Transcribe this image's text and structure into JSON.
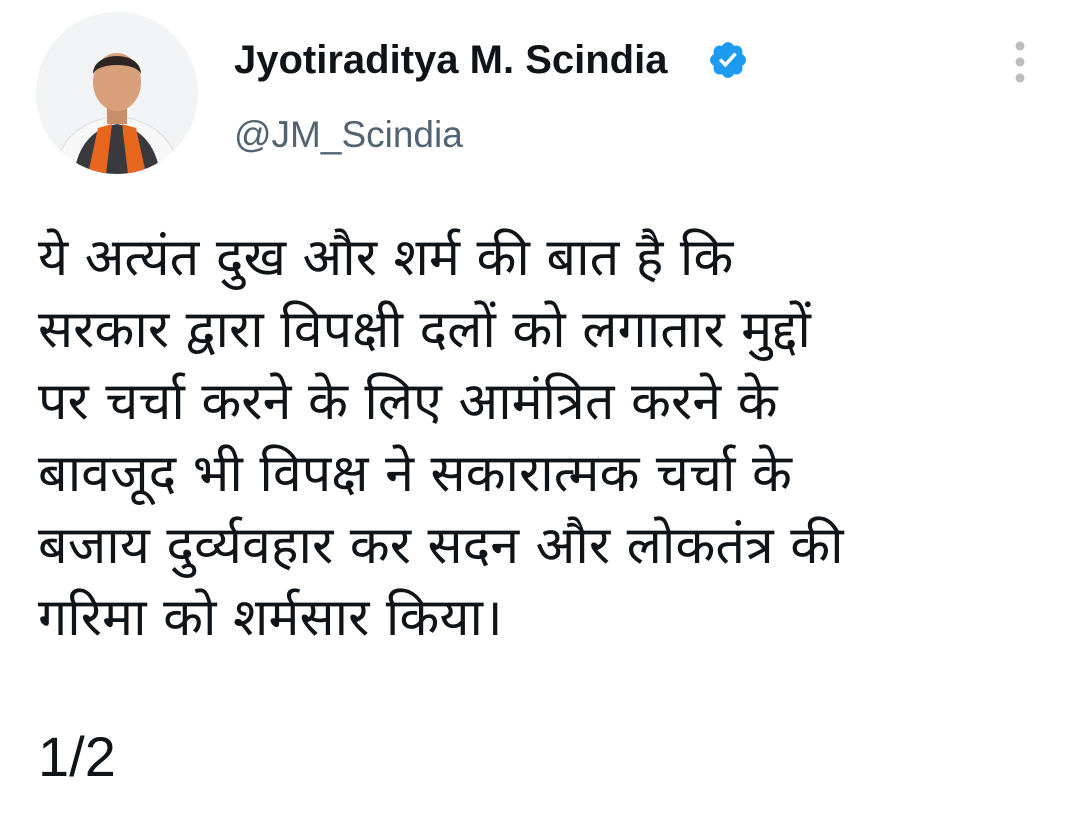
{
  "user": {
    "display_name": "Jyotiraditya M. Scindia",
    "handle": "@JM_Scindia",
    "verified": true,
    "avatar_icon": "profile-photo",
    "verified_icon": "verified-badge-icon",
    "verified_color": "#1d9bf0"
  },
  "menu": {
    "icon": "more-vertical-icon"
  },
  "tweet": {
    "lines": [
      "ये अत्यंत दुख और शर्म की बात है कि",
      "सरकार द्वारा विपक्षी दलों को लगातार मुद्दों",
      "पर चर्चा करने के लिए आमंत्रित करने के",
      "बावजूद भी विपक्ष ने सकारात्मक चर्चा के",
      "बजाय दुर्व्यवहार कर सदन और लोकतंत्र की",
      "गरिमा को शर्मसार किया।"
    ],
    "thread_position": "1/2"
  },
  "colors": {
    "text_primary": "#0f1419",
    "text_secondary": "#536471",
    "accent": "#1d9bf0"
  }
}
